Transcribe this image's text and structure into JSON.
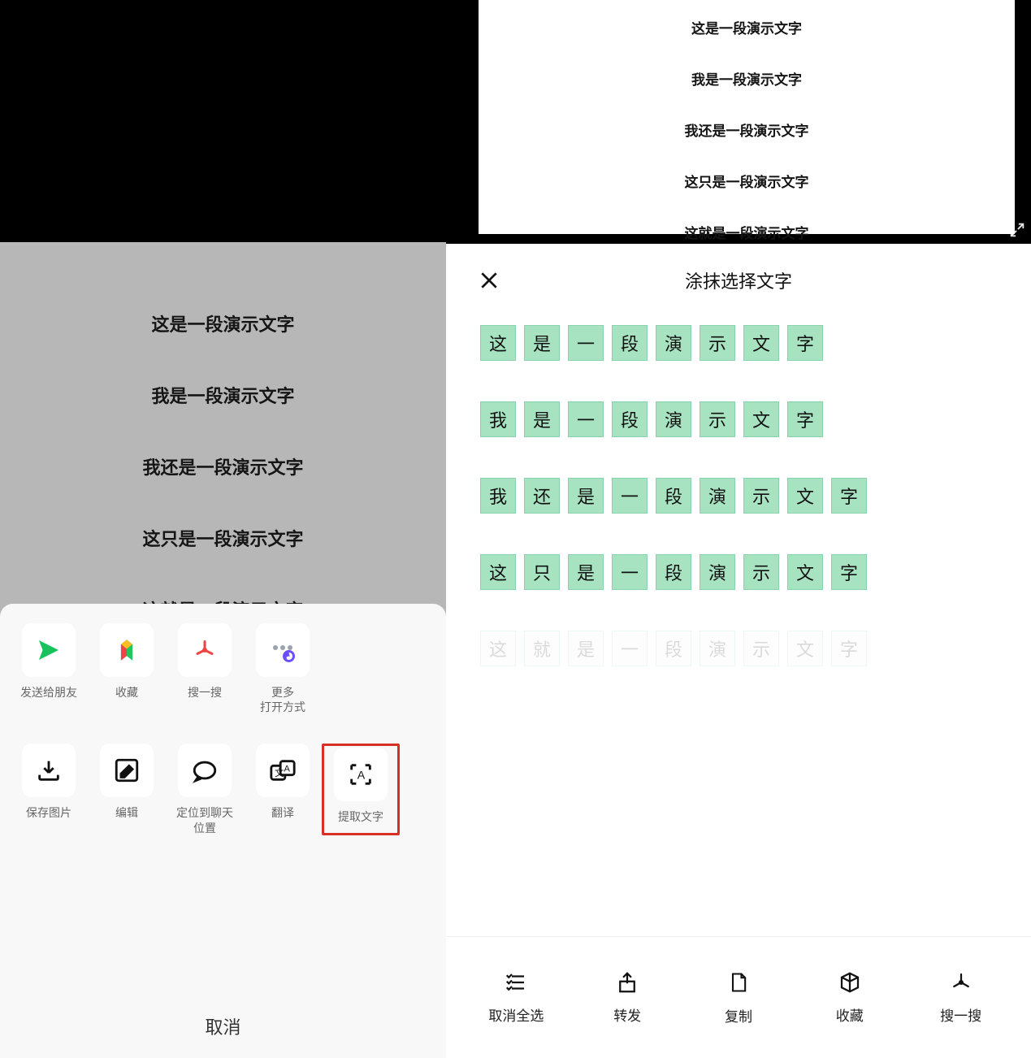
{
  "left_demo_lines": [
    "这是一段演示文字",
    "我是一段演示文字",
    "我还是一段演示文字",
    "这只是一段演示文字",
    "这就是一段演示文字"
  ],
  "sheet_row1": [
    {
      "icon": "share",
      "label": "发送给朋友"
    },
    {
      "icon": "favorite",
      "label": "收藏"
    },
    {
      "icon": "search-app",
      "label": "搜一搜"
    },
    {
      "icon": "more",
      "label": "更多\n打开方式"
    }
  ],
  "sheet_row2": [
    {
      "icon": "download",
      "label": "保存图片"
    },
    {
      "icon": "edit",
      "label": "编辑"
    },
    {
      "icon": "locate",
      "label": "定位到聊天\n位置"
    },
    {
      "icon": "translate",
      "label": "翻译"
    },
    {
      "icon": "extract-text",
      "label": "提取文字"
    }
  ],
  "cancel_label": "取消",
  "right_paper_lines": [
    "这是一段演示文字",
    "我是一段演示文字",
    "我还是一段演示文字",
    "这只是一段演示文字",
    "这就是一段演示文字"
  ],
  "panel_title": "涂抹选择文字",
  "char_rows": [
    [
      "这",
      "是",
      "一",
      "段",
      "演",
      "示",
      "文",
      "字"
    ],
    [
      "我",
      "是",
      "一",
      "段",
      "演",
      "示",
      "文",
      "字"
    ],
    [
      "我",
      "还",
      "是",
      "一",
      "段",
      "演",
      "示",
      "文",
      "字"
    ],
    [
      "这",
      "只",
      "是",
      "一",
      "段",
      "演",
      "示",
      "文",
      "字"
    ]
  ],
  "fade_row": [
    "这",
    "就",
    "是",
    "一",
    "段",
    "演",
    "示",
    "文",
    "字"
  ],
  "bottom_actions": [
    {
      "icon": "deselect",
      "label": "取消全选"
    },
    {
      "icon": "forward",
      "label": "转发"
    },
    {
      "icon": "copy",
      "label": "复制"
    },
    {
      "icon": "collect",
      "label": "收藏"
    },
    {
      "icon": "search",
      "label": "搜一搜"
    }
  ]
}
